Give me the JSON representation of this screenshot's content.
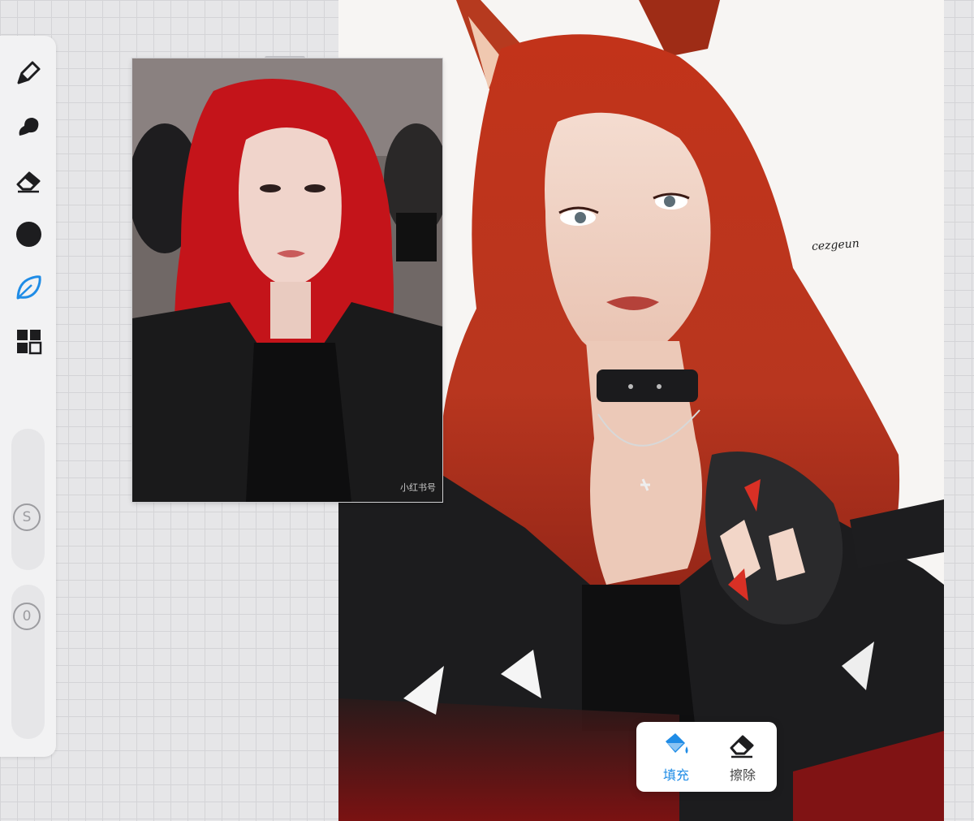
{
  "toolbar": {
    "tools": [
      {
        "name": "pencil-tool",
        "icon": "pencil-icon",
        "active": false
      },
      {
        "name": "smudge-tool",
        "icon": "smudge-icon",
        "active": false
      },
      {
        "name": "eraser-tool",
        "icon": "eraser-icon",
        "active": false
      },
      {
        "name": "color-tool",
        "icon": "color-dot-icon",
        "color": "#1d1d1f",
        "active": false
      },
      {
        "name": "lasso-tool",
        "icon": "leaf-lasso-icon",
        "active": true
      },
      {
        "name": "layers-tool",
        "icon": "grid-icon",
        "active": false
      }
    ],
    "size_label": "S",
    "opacity_label": "0",
    "accent_color": "#1f8ce6"
  },
  "reference": {
    "watermark": "小红书号"
  },
  "artwork": {
    "signature": "cezgeun"
  },
  "popover": {
    "fill_label": "填充",
    "erase_label": "擦除",
    "fill_color": "#1f8ce6"
  }
}
